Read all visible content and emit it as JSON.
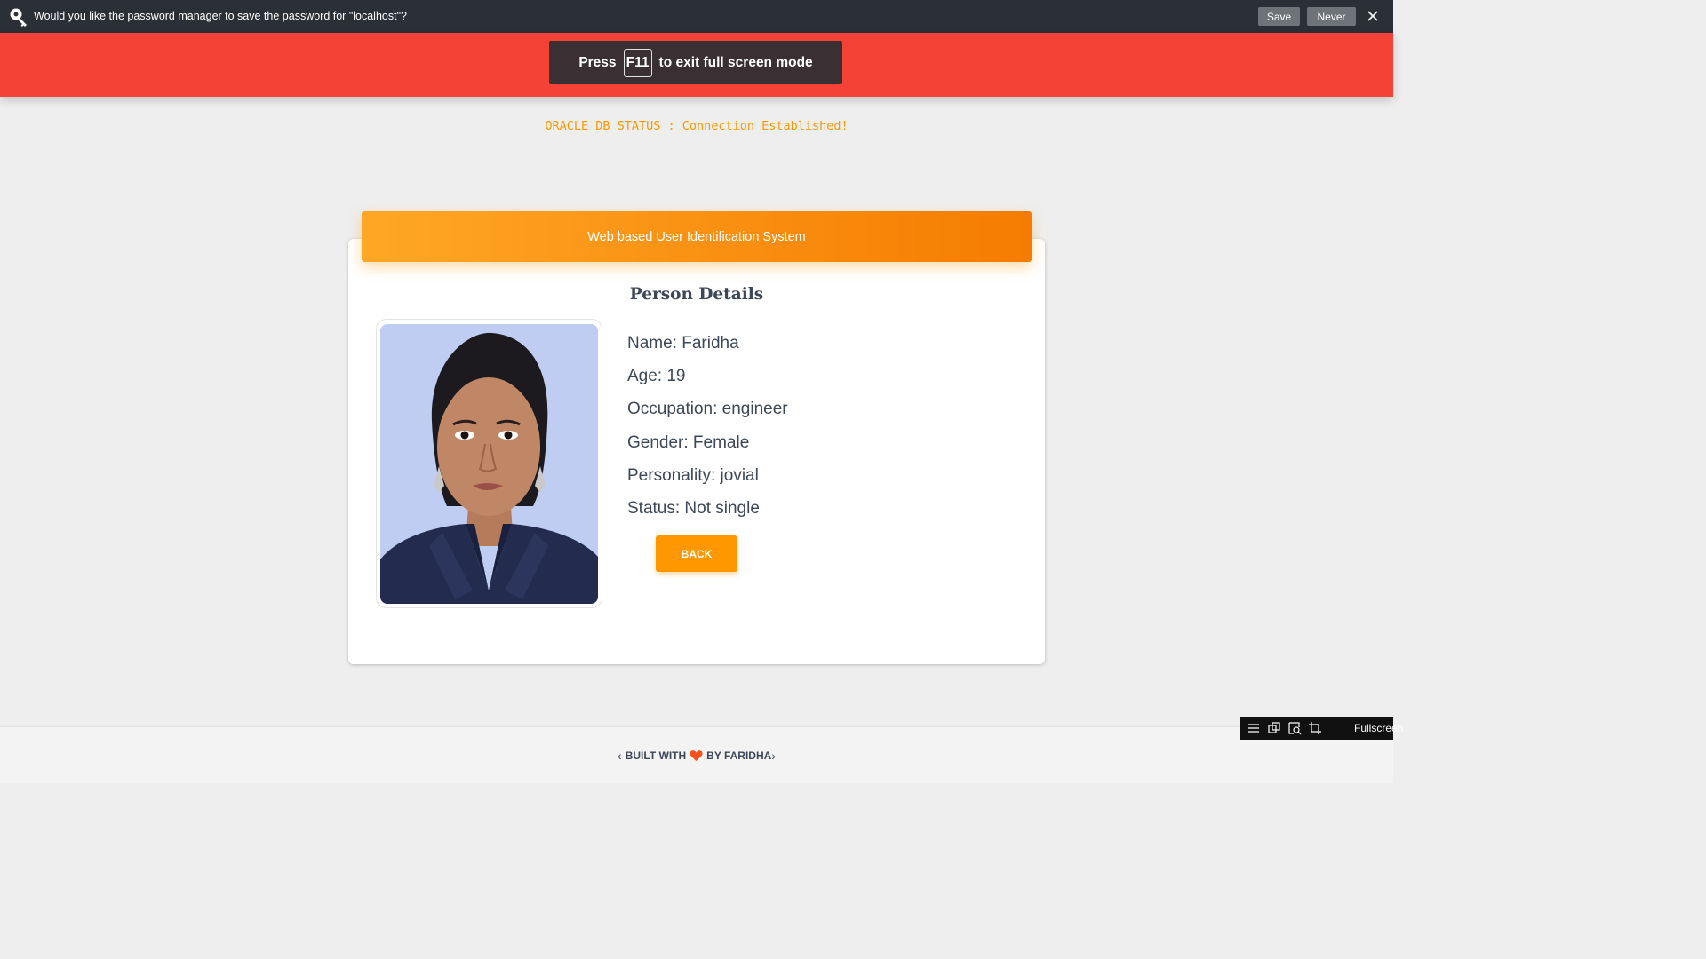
{
  "password_prompt": {
    "message": "Would you like the password manager to save the password for \"localhost\"?",
    "save_label": "Save",
    "never_label": "Never"
  },
  "fullscreen_toast": {
    "press": "Press",
    "key": "F11",
    "suffix": "to exit full screen mode"
  },
  "db_status": "ORACLE DB STATUS : Connection Established!",
  "card": {
    "header": "Web based User Identification System",
    "title": "Person Details",
    "details": [
      "Name: Faridha",
      "Age: 19",
      "Occupation: engineer",
      "Gender: Female",
      "Personality: jovial",
      "Status: Not single"
    ],
    "back_label": "BACK"
  },
  "footer": {
    "left_chevron": "‹",
    "built_with": "BUILT WITH",
    "by": "BY FARIDHA",
    "right_chevron": "›"
  },
  "fullscreen_widget": {
    "label": "Fullscreen"
  },
  "colors": {
    "navbar": "#f44336",
    "accent": "#ff9800",
    "text": "#3c4858"
  }
}
